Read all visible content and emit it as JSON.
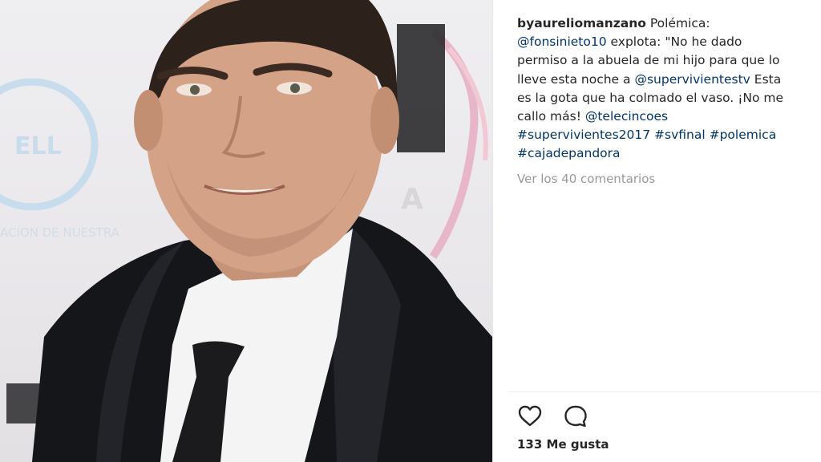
{
  "post": {
    "username": "byaureliomanzano",
    "caption": [
      {
        "type": "text",
        "text": " Polémica: "
      },
      {
        "type": "mention",
        "text": "@fonsinieto10"
      },
      {
        "type": "text",
        "text": " explota: \"No he dado permiso a la abuela de mi hijo para que lo lleve esta noche a "
      },
      {
        "type": "mention",
        "text": "@supervivientestv"
      },
      {
        "type": "text",
        "text": " Esta es la gota que ha colmado el vaso. ¡No me callo más! "
      },
      {
        "type": "mention",
        "text": "@telecincoes"
      },
      {
        "type": "text",
        "text": " "
      },
      {
        "type": "hashtag",
        "text": "#supervivientes2017"
      },
      {
        "type": "text",
        "text": " "
      },
      {
        "type": "hashtag",
        "text": "#svfinal"
      },
      {
        "type": "text",
        "text": " "
      },
      {
        "type": "hashtag",
        "text": "#polemica"
      },
      {
        "type": "text",
        "text": " "
      },
      {
        "type": "hashtag",
        "text": "#cajadepandora"
      }
    ],
    "view_comments": "Ver los 40 comentarios",
    "likes": "133 Me gusta"
  },
  "icons": {
    "like": "heart-outline-icon",
    "comment": "speech-bubble-icon"
  },
  "colors": {
    "link": "#003569",
    "muted": "#999999",
    "text": "#262626"
  }
}
